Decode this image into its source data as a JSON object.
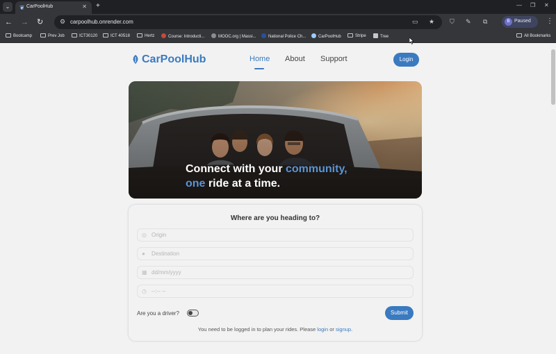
{
  "browser": {
    "tab_title": "CarPoolHub",
    "url": "carpoolhub.onrender.com",
    "profile_initial": "B",
    "profile_label": "Paused",
    "bookmarks": [
      {
        "label": "Bootcamp",
        "kind": "folder"
      },
      {
        "label": "Prev Job",
        "kind": "folder"
      },
      {
        "label": "ICT30120",
        "kind": "folder"
      },
      {
        "label": "ICT 40518",
        "kind": "folder"
      },
      {
        "label": "Hertz",
        "kind": "folder"
      },
      {
        "label": "Course: Introducti...",
        "kind": "site"
      },
      {
        "label": "MOOC.org | Massi...",
        "kind": "site"
      },
      {
        "label": "National Police Ch...",
        "kind": "site"
      },
      {
        "label": "CarPoolHub",
        "kind": "site"
      },
      {
        "label": "Stripe",
        "kind": "folder"
      },
      {
        "label": "Tree",
        "kind": "site"
      }
    ],
    "all_bookmarks": "All Bookmarks"
  },
  "header": {
    "brand": "CarPoolHub",
    "nav": [
      {
        "label": "Home",
        "active": true
      },
      {
        "label": "About",
        "active": false
      },
      {
        "label": "Support",
        "active": false
      }
    ],
    "login_label": "Login"
  },
  "hero": {
    "line1_a": "Connect with your ",
    "line1_b": "community,",
    "line2_a": "one",
    "line2_b": " ride at a time."
  },
  "planner": {
    "title": "Where are you heading to?",
    "origin_placeholder": "Origin",
    "destination_placeholder": "Destination",
    "date_placeholder": "dd/mm/yyyy",
    "time_placeholder": "--:-- --",
    "driver_label": "Are you a driver?",
    "submit_label": "Submit",
    "note_prefix": "You need to be logged in to plan your rides. Please ",
    "note_login": "login",
    "note_or": " or ",
    "note_signup": "signup",
    "note_suffix": "."
  },
  "colors": {
    "brand": "#3a7ac0",
    "page_bg": "#f2f2f2",
    "chrome_dark": "#35363a"
  }
}
